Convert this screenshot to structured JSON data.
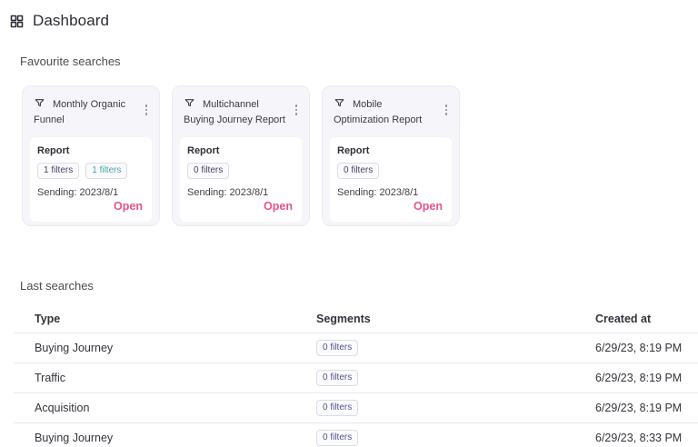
{
  "colors": {
    "accent_pink": "#e9528b",
    "chip_indigo": "#474368",
    "chip_teal": "#43a6a6",
    "card_background": "#f5f5fa"
  },
  "header": {
    "title": "Dashboard"
  },
  "favourites": {
    "section_label": "Favourite searches",
    "cards": [
      {
        "title": "Monthly Organic Funnel",
        "type_label": "Report",
        "chips": [
          {
            "label": "1 filters",
            "color": "indigo"
          },
          {
            "label": "1 filters",
            "color": "teal"
          }
        ],
        "sending_label": "Sending: 2023/8/1",
        "open_label": "Open"
      },
      {
        "title": "Multichannel Buying Journey Report",
        "type_label": "Report",
        "chips": [
          {
            "label": "0 filters",
            "color": "indigo"
          }
        ],
        "sending_label": "Sending: 2023/8/1",
        "open_label": "Open"
      },
      {
        "title": "Mobile Optimization Report",
        "type_label": "Report",
        "chips": [
          {
            "label": "0 filters",
            "color": "indigo"
          }
        ],
        "sending_label": "Sending: 2023/8/1",
        "open_label": "Open"
      }
    ]
  },
  "last_searches": {
    "section_label": "Last searches",
    "columns": [
      "Type",
      "Segments",
      "Created at"
    ],
    "rows": [
      {
        "type": "Buying Journey",
        "segments": "0 filters",
        "created_at": "6/29/23, 8:19 PM"
      },
      {
        "type": "Traffic",
        "segments": "0 filters",
        "created_at": "6/29/23, 8:19 PM"
      },
      {
        "type": "Acquisition",
        "segments": "0 filters",
        "created_at": "6/29/23, 8:19 PM"
      },
      {
        "type": "Buying Journey",
        "segments": "0 filters",
        "created_at": "6/29/23, 8:33 PM"
      }
    ]
  }
}
